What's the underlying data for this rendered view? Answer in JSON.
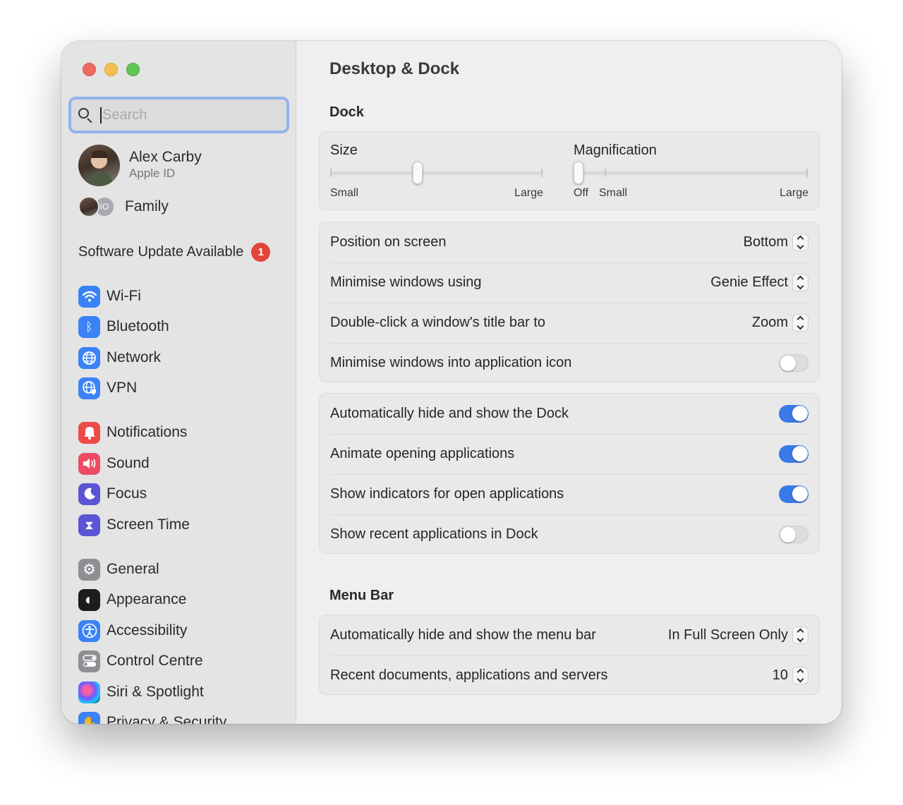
{
  "window": {
    "traffic_lights": [
      "close",
      "minimize",
      "zoom"
    ]
  },
  "sidebar": {
    "search_placeholder": "Search",
    "profile": {
      "name": "Alex Carby",
      "subtitle": "Apple ID"
    },
    "family": {
      "label": "Family",
      "initials": "IO"
    },
    "update": {
      "label": "Software Update Available",
      "badge": "1"
    },
    "items": [
      {
        "label": "Wi-Fi",
        "icon": "wifi-icon",
        "color": "#3b82f6",
        "glyph": ""
      },
      {
        "label": "Bluetooth",
        "icon": "bluetooth-icon",
        "color": "#3b82f6",
        "glyph": "ᛒ"
      },
      {
        "label": "Network",
        "icon": "globe-icon",
        "color": "#3b82f6",
        "glyph": ""
      },
      {
        "label": "VPN",
        "icon": "vpn-globe-icon",
        "color": "#3b82f6",
        "glyph": ""
      },
      {
        "label": "Notifications",
        "icon": "bell-icon",
        "color": "#ec4b47",
        "glyph": ""
      },
      {
        "label": "Sound",
        "icon": "speaker-icon",
        "color": "#ec4b63",
        "glyph": ""
      },
      {
        "label": "Focus",
        "icon": "moon-icon",
        "color": "#5b55d6",
        "glyph": ""
      },
      {
        "label": "Screen Time",
        "icon": "hourglass-icon",
        "color": "#5b55d6",
        "glyph": "⧗"
      },
      {
        "label": "General",
        "icon": "gear-icon",
        "color": "#8e8e93",
        "glyph": "⚙"
      },
      {
        "label": "Appearance",
        "icon": "appearance-icon",
        "color": "#1c1c1e",
        "glyph": "◐"
      },
      {
        "label": "Accessibility",
        "icon": "accessibility-icon",
        "color": "#3b82f6",
        "glyph": "♿"
      },
      {
        "label": "Control Centre",
        "icon": "control-centre-icon",
        "color": "#8e8e93",
        "glyph": ""
      },
      {
        "label": "Siri & Spotlight",
        "icon": "siri-icon",
        "color": "#3a3a5a",
        "glyph": ""
      },
      {
        "label": "Privacy & Security",
        "icon": "hand-icon",
        "color": "#3b82f6",
        "glyph": "✋"
      }
    ]
  },
  "main": {
    "title": "Desktop & Dock",
    "dock": {
      "heading": "Dock",
      "size_slider": {
        "title": "Size",
        "min_label": "Small",
        "max_label": "Large",
        "value": 0.41
      },
      "magnification_slider": {
        "title": "Magnification",
        "off_label": "Off",
        "min_label": "Small",
        "max_label": "Large",
        "value": 0.0
      },
      "position": {
        "label": "Position on screen",
        "value": "Bottom"
      },
      "minimise_using": {
        "label": "Minimise windows using",
        "value": "Genie Effect"
      },
      "double_click": {
        "label": "Double-click a window's title bar to",
        "value": "Zoom"
      },
      "minimise_into_icon": {
        "label": "Minimise windows into application icon",
        "on": false
      },
      "auto_hide": {
        "label": "Automatically hide and show the Dock",
        "on": true
      },
      "animate": {
        "label": "Animate opening applications",
        "on": true
      },
      "indicators": {
        "label": "Show indicators for open applications",
        "on": true
      },
      "recent_apps": {
        "label": "Show recent applications in Dock",
        "on": false
      }
    },
    "menu_bar": {
      "heading": "Menu Bar",
      "auto_hide": {
        "label": "Automatically hide and show the menu bar",
        "value": "In Full Screen Only"
      },
      "recent_docs": {
        "label": "Recent documents, applications and servers",
        "value": "10"
      }
    }
  }
}
